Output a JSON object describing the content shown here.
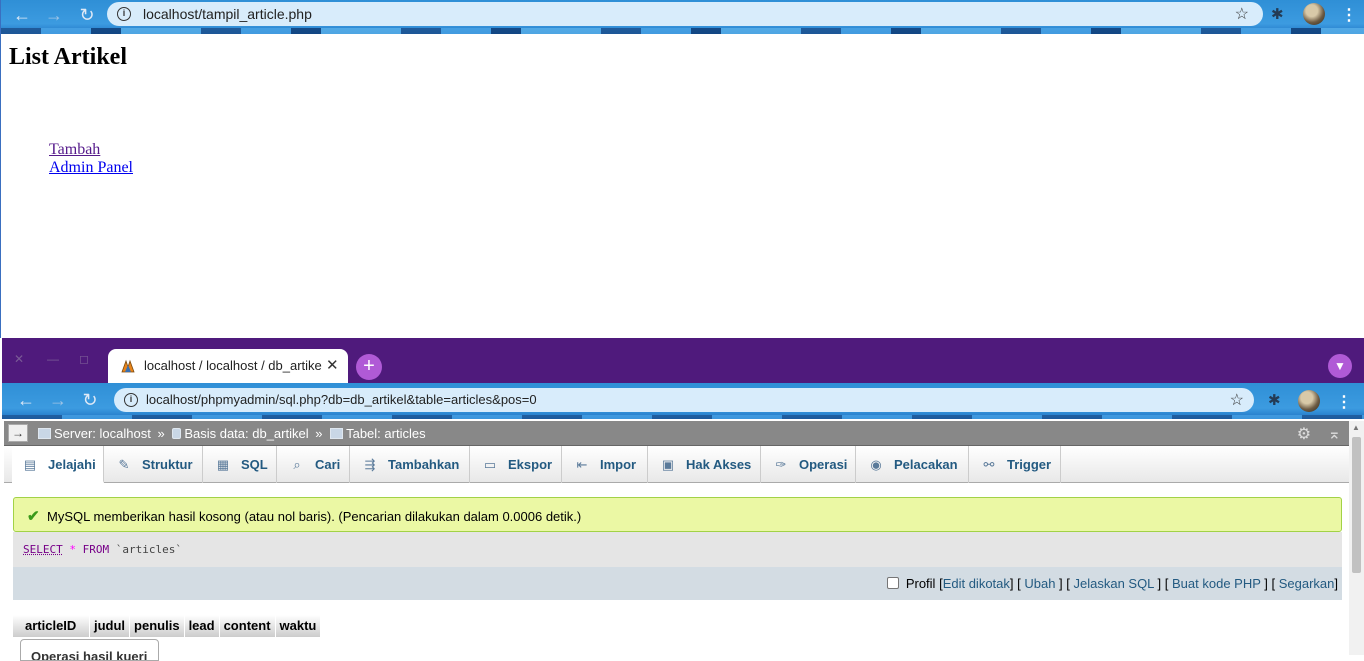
{
  "top_window": {
    "url": "localhost/tampil_article.php",
    "page_title": "List Artikel",
    "links": [
      "Tambah",
      "Admin Panel"
    ]
  },
  "bottom_window": {
    "tab_title": "localhost / localhost / db_artikel",
    "url": "localhost/phpmyadmin/sql.php?db=db_artikel&table=articles&pos=0",
    "breadcrumb": {
      "server": "Server: localhost",
      "database": "Basis data: db_artikel",
      "table": "Tabel: articles",
      "separator": "»"
    },
    "menu_tabs": [
      "Jelajahi",
      "Struktur",
      "SQL",
      "Cari",
      "Tambahkan",
      "Ekspor",
      "Impor",
      "Hak Akses",
      "Operasi",
      "Pelacakan",
      "Trigger"
    ],
    "notice": "MySQL memberikan hasil kosong (atau nol baris). (Pencarian dilakukan dalam 0.0006 detik.)",
    "sql": {
      "select": "SELECT",
      "star": "*",
      "from": "FROM",
      "table": "`articles`"
    },
    "query_links": {
      "profil_label": "Profil",
      "edit_inline": "Edit dikotak",
      "edit": "Ubah",
      "explain": "Jelaskan SQL",
      "create_php": "Buat kode PHP",
      "refresh": "Segarkan"
    },
    "columns": [
      "articleID",
      "judul",
      "penulis",
      "lead",
      "content",
      "waktu"
    ],
    "query_ops_button": "Operasi hasil kueri"
  },
  "colors": {
    "pma_link": "#235a81",
    "notice_bg": "#ebf8a4",
    "tabstrip": "#4f1a7c",
    "toolbar": "#3c9be0"
  }
}
